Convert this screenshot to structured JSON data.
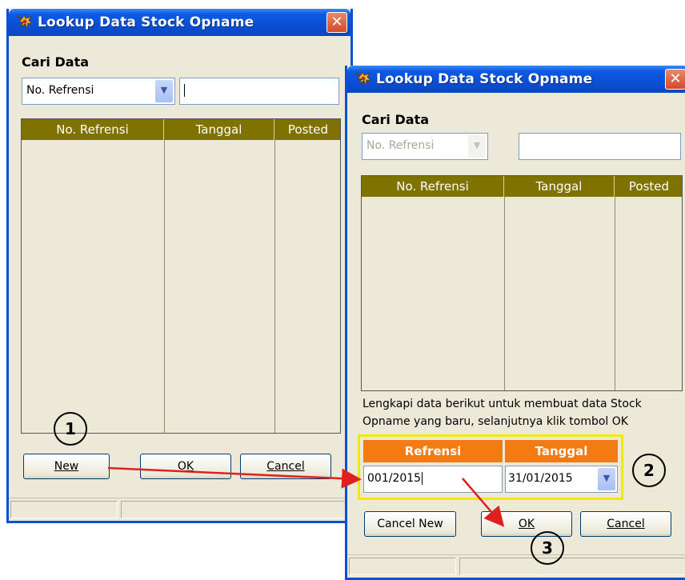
{
  "window1": {
    "title": "Lookup Data Stock Opname",
    "search_label": "Cari Data",
    "search_field_value": "No. Refrensi",
    "search_input_value": "",
    "columns": [
      "No. Refrensi",
      "Tanggal",
      "Posted"
    ],
    "buttons": {
      "new": "New",
      "ok": "OK",
      "cancel": "Cancel"
    }
  },
  "window2": {
    "title": "Lookup Data Stock Opname",
    "search_label": "Cari Data",
    "search_field_value": "No. Refrensi",
    "search_input_value": "",
    "columns": [
      "No. Refrensi",
      "Tanggal",
      "Posted"
    ],
    "hint_line1": "Lengkapi data berikut untuk membuat data Stock",
    "hint_line2": "Opname yang baru, selanjutnya klik tombol OK",
    "form": {
      "refrensi_label": "Refrensi",
      "tanggal_label": "Tanggal",
      "refrensi_value": "001/2015",
      "tanggal_value": "31/01/2015"
    },
    "buttons": {
      "cancel_new": "Cancel New",
      "ok": "OK",
      "cancel": "Cancel"
    }
  },
  "annotations": {
    "step1": "1",
    "step2": "2",
    "step3": "3"
  },
  "icons": {
    "app": "app-icon",
    "close": "close-icon",
    "dropdown": "chevron-down-icon"
  },
  "colors": {
    "titlebar": "#0a4fd4",
    "grid_header": "#7f7200",
    "form_header": "#f47a12",
    "highlight": "#f5e800",
    "arrow": "#e02020"
  }
}
